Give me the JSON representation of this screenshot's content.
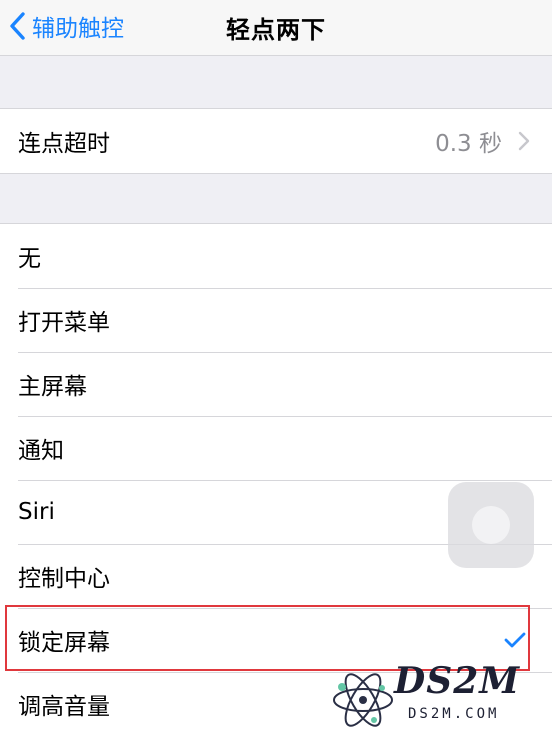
{
  "nav": {
    "back_label": "辅助触控",
    "title": "轻点两下"
  },
  "timeout": {
    "label": "连点超时",
    "value": "0.3 秒"
  },
  "actions": [
    {
      "label": "无",
      "selected": false
    },
    {
      "label": "打开菜单",
      "selected": false
    },
    {
      "label": "主屏幕",
      "selected": false
    },
    {
      "label": "通知",
      "selected": false
    },
    {
      "label": "Siri",
      "selected": false
    },
    {
      "label": "控制中心",
      "selected": false
    },
    {
      "label": "锁定屏幕",
      "selected": true
    },
    {
      "label": "调高音量",
      "selected": false
    }
  ],
  "watermark": {
    "brand": "DS2M",
    "site": "DS2M.COM"
  },
  "colors": {
    "accent": "#1a84ff",
    "highlight": "#e0383d"
  },
  "icons": {
    "back": "chevron-left-icon",
    "disclosure": "chevron-right-icon",
    "selected": "checkmark-icon"
  }
}
